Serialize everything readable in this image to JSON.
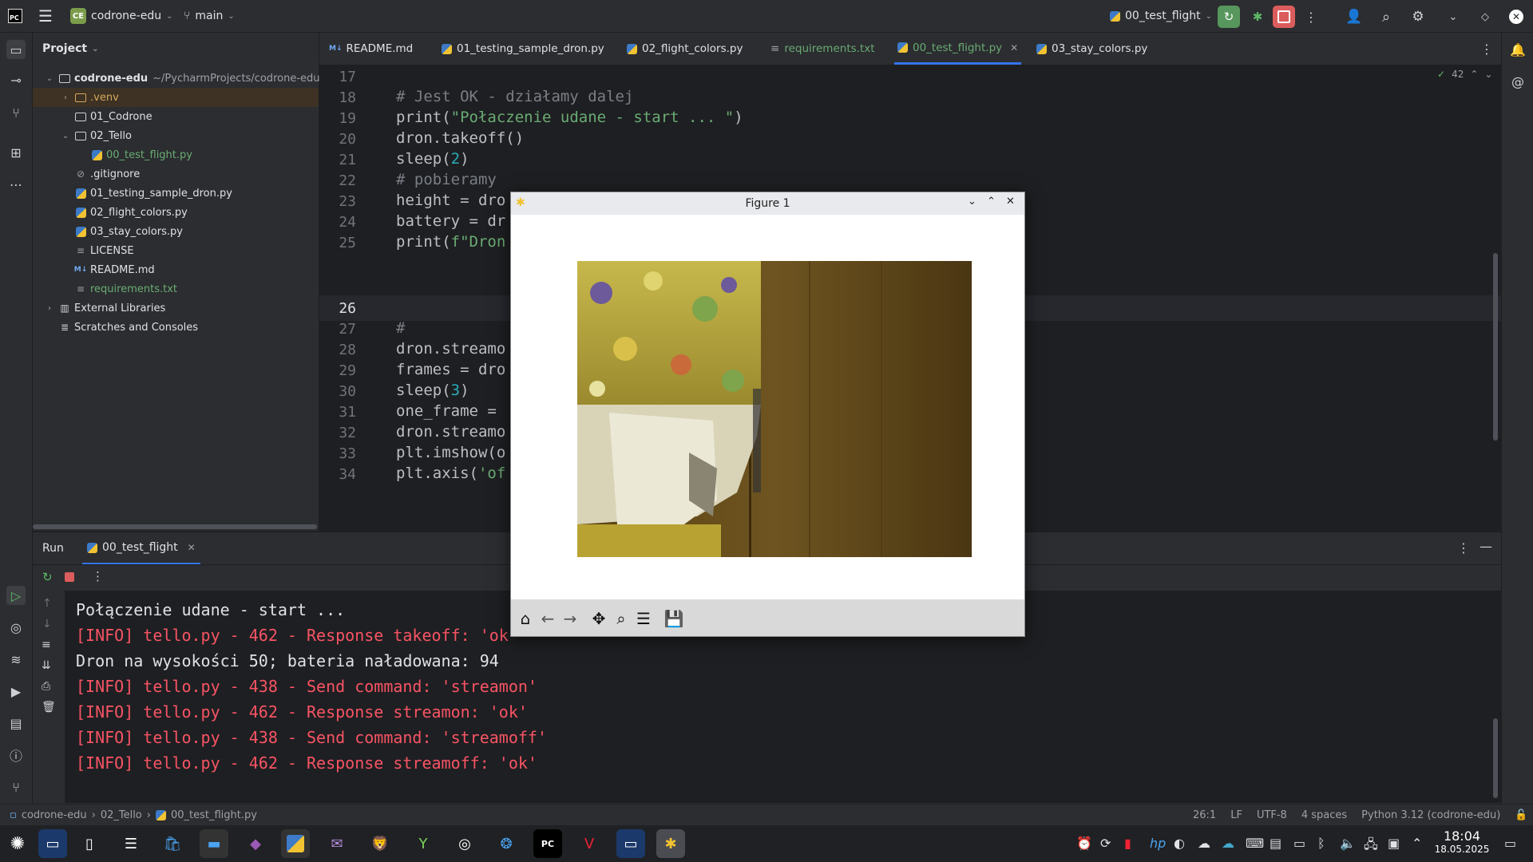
{
  "titlebar": {
    "project_badge": "CE",
    "project_name": "codrone-edu",
    "branch": "main",
    "run_config": "00_test_flight"
  },
  "project_panel": {
    "title": "Project",
    "tree": [
      {
        "label": "codrone-edu",
        "path": "~/PycharmProjects/codrone-edu"
      },
      {
        "label": ".venv"
      },
      {
        "label": "01_Codrone"
      },
      {
        "label": "02_Tello"
      },
      {
        "label": "00_test_flight.py"
      },
      {
        "label": ".gitignore"
      },
      {
        "label": "01_testing_sample_dron.py"
      },
      {
        "label": "02_flight_colors.py"
      },
      {
        "label": "03_stay_colors.py"
      },
      {
        "label": "LICENSE"
      },
      {
        "label": "README.md"
      },
      {
        "label": "requirements.txt"
      },
      {
        "label": "External Libraries"
      },
      {
        "label": "Scratches and Consoles"
      }
    ]
  },
  "editor_tabs": [
    {
      "label": "README.md",
      "icon": "M↓"
    },
    {
      "label": "01_testing_sample_dron.py"
    },
    {
      "label": "02_flight_colors.py"
    },
    {
      "label": "requirements.txt"
    },
    {
      "label": "00_test_flight.py"
    },
    {
      "label": "03_stay_colors.py"
    }
  ],
  "editor": {
    "problems_count": "42",
    "lines": [
      {
        "n": "17",
        "text": ""
      },
      {
        "n": "18",
        "text": "# Jest OK - działamy dalej"
      },
      {
        "n": "19",
        "text_a": "print(",
        "text_b": "\"Połaczenie udane - start ... \"",
        "text_c": ")"
      },
      {
        "n": "20",
        "text": "dron.takeoff()"
      },
      {
        "n": "21",
        "text_a": "sleep(",
        "text_b": "2",
        "text_c": ")"
      },
      {
        "n": "22",
        "text": "# pobieramy"
      },
      {
        "n": "23",
        "text": "height = dro"
      },
      {
        "n": "24",
        "text": "battery = dr"
      },
      {
        "n": "25",
        "text_a": "print(",
        "text_b": "f\"Dron",
        "text_c": "\")"
      },
      {
        "n": "26",
        "text": ""
      },
      {
        "n": "27",
        "text": "#"
      },
      {
        "n": "28",
        "text": "dron.streamo"
      },
      {
        "n": "29",
        "text": "frames = dro"
      },
      {
        "n": "30",
        "text_a": "sleep(",
        "text_b": "3",
        "text_c": ")"
      },
      {
        "n": "31",
        "text": "one_frame ="
      },
      {
        "n": "32",
        "text": "dron.streamo"
      },
      {
        "n": "33",
        "text": "plt.imshow(o"
      },
      {
        "n": "34",
        "text_a": "plt.axis(",
        "text_b": "'of",
        "text_c": ""
      }
    ]
  },
  "run_panel": {
    "tab_run": "Run",
    "tab_config": "00_test_flight",
    "console": [
      {
        "text": "Połączenie udane - start ...",
        "color": "white"
      },
      {
        "text": "[INFO] tello.py - 462 - Response takeoff: 'ok",
        "color": "red"
      },
      {
        "text": "Dron na wysokości 50; bateria naładowana: 94",
        "color": "white"
      },
      {
        "text": "[INFO] tello.py - 438 - Send command: 'streamon'",
        "color": "red"
      },
      {
        "text": "[INFO] tello.py - 462 - Response streamon: 'ok'",
        "color": "red"
      },
      {
        "text": "[INFO] tello.py - 438 - Send command: 'streamoff'",
        "color": "red"
      },
      {
        "text": "[INFO] tello.py - 462 - Response streamoff: 'ok'",
        "color": "red"
      }
    ]
  },
  "figure": {
    "title": "Figure 1"
  },
  "statusbar": {
    "crumb1": "codrone-edu",
    "crumb2": "02_Tello",
    "crumb3": "00_test_flight.py",
    "position": "26:1",
    "line_sep": "LF",
    "encoding": "UTF-8",
    "indent": "4 spaces",
    "interpreter": "Python 3.12 (codrone-edu)"
  },
  "taskbar": {
    "time": "18:04",
    "date": "18.05.2025"
  },
  "colors": {
    "accent": "#3574f0",
    "error": "#f75464",
    "run_green": "#57965c",
    "stop_red": "#db5c5c"
  }
}
